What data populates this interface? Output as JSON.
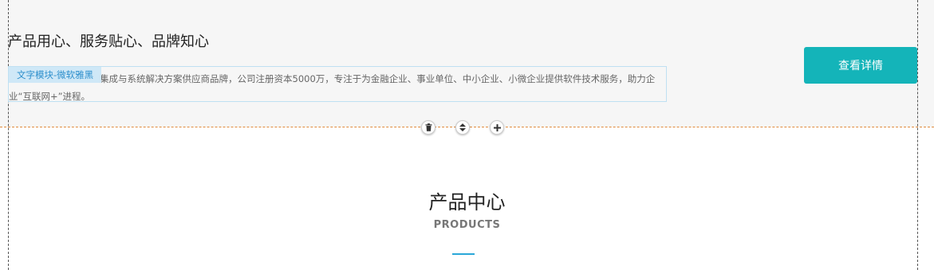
{
  "banner": {
    "headline": "产品用心、服务贴心、品牌知心",
    "module_tag": "文字模块-微软雅黑",
    "body_text": "集成与系统解决方案供应商品牌，公司注册资本5000万，专注于为金融企业、事业单位、中小企业、小微企业提供软件技术服务，助力企业“互联网+”进程。",
    "cta_label": "查看详情"
  },
  "editor_tools": [
    {
      "name": "delete",
      "icon": "trash-icon"
    },
    {
      "name": "move",
      "icon": "sort-arrows-icon"
    },
    {
      "name": "add",
      "icon": "plus-icon"
    }
  ],
  "section": {
    "title": "产品中心",
    "subtitle": "PRODUCTS"
  },
  "colors": {
    "accent": "#14b4b9",
    "tag_bg": "#cfe8f7",
    "tag_text": "#2d8fcc",
    "underline": "#2aa7d8",
    "guide_orange": "#e08a3c"
  }
}
